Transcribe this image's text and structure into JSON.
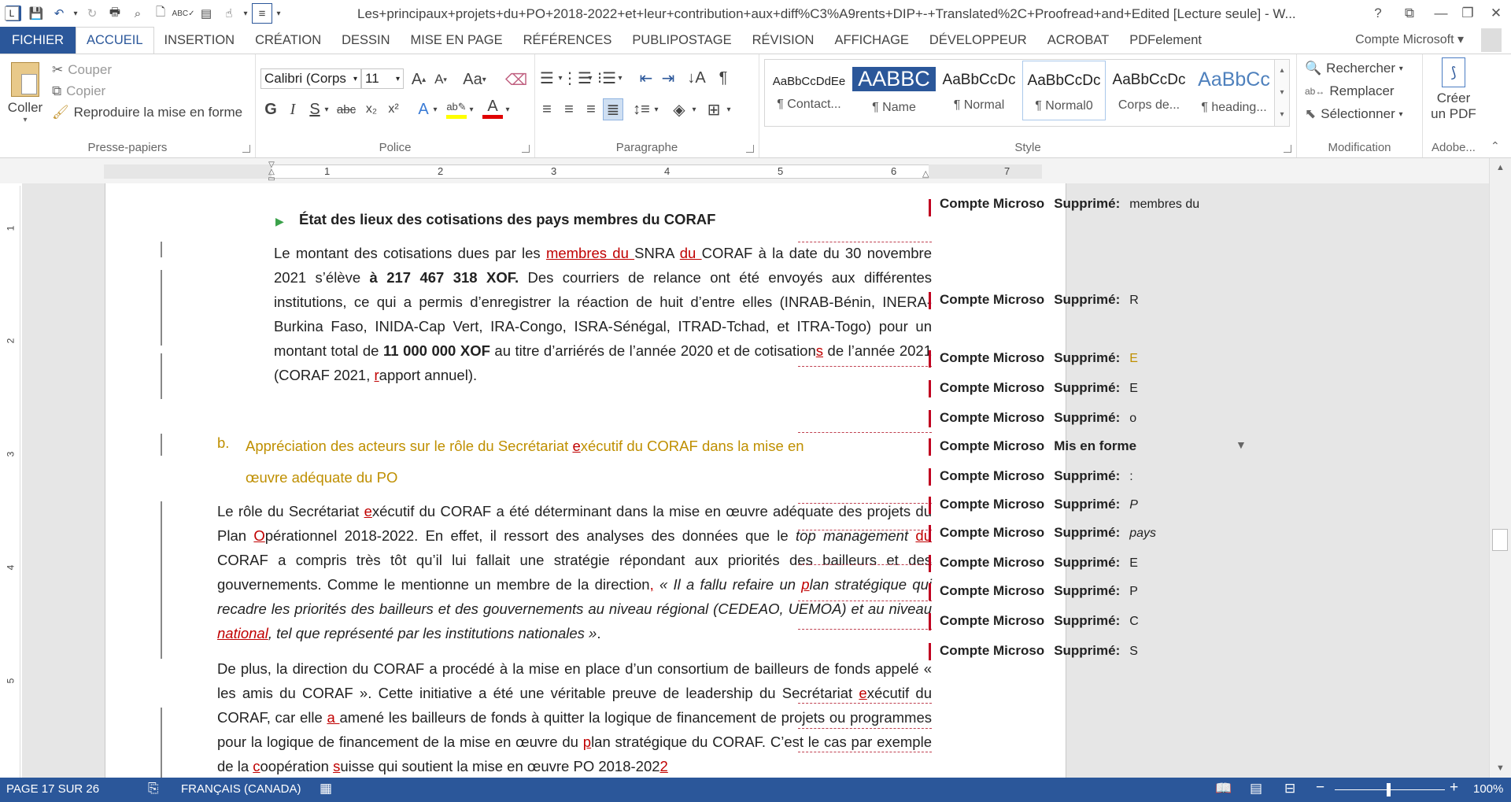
{
  "titlebar": {
    "title": "Les+principaux+projets+du+PO+2018-2022+et+leur+contribution+aux+diff%C3%A9rents+DIP+-+Translated%2C+Proofread+and+Edited [Lecture seule] - W...",
    "help": "?"
  },
  "tabs": [
    {
      "label": "FICHIER"
    },
    {
      "label": "ACCUEIL"
    },
    {
      "label": "INSERTION"
    },
    {
      "label": "CRÉATION"
    },
    {
      "label": "DESSIN"
    },
    {
      "label": "MISE EN PAGE"
    },
    {
      "label": "RÉFÉRENCES"
    },
    {
      "label": "PUBLIPOSTAGE"
    },
    {
      "label": "RÉVISION"
    },
    {
      "label": "AFFICHAGE"
    },
    {
      "label": "DÉVELOPPEUR"
    },
    {
      "label": "ACROBAT"
    },
    {
      "label": "PDFelement"
    }
  ],
  "account": "Compte Microsoft",
  "clipboard": {
    "paste": "Coller",
    "cut": "Couper",
    "copy": "Copier",
    "format_painter": "Reproduire la mise en forme",
    "label": "Presse-papiers"
  },
  "font": {
    "name": "Calibri (Corps",
    "size": "11",
    "label": "Police",
    "bold": "G",
    "italic": "I",
    "underline": "S",
    "strike": "abc",
    "sub": "x₂",
    "sup": "x²",
    "case": "Aa"
  },
  "paragraph": {
    "label": "Paragraphe"
  },
  "styles": {
    "label": "Style",
    "items": [
      {
        "preview": "AaBbCcDdEe",
        "name": "¶ Contact..."
      },
      {
        "preview": "AABBC",
        "name": "¶ Name"
      },
      {
        "preview": "AaBbCcDc",
        "name": "¶ Normal"
      },
      {
        "preview": "AaBbCcDc",
        "name": "¶ Normal0"
      },
      {
        "preview": "AaBbCcDc",
        "name": "Corps de..."
      },
      {
        "preview": "AaBbCc",
        "name": "¶ heading..."
      }
    ]
  },
  "editing": {
    "find": "Rechercher",
    "replace": "Remplacer",
    "select": "Sélectionner",
    "label": "Modification"
  },
  "adobe": {
    "create_pdf_1": "Créer",
    "create_pdf_2": "un PDF",
    "label": "Adobe..."
  },
  "ruler": {
    "numbers": [
      "1",
      "2",
      "3",
      "4",
      "5",
      "6",
      "7"
    ],
    "vnumbers": [
      "1",
      "2",
      "3",
      "4",
      "5"
    ]
  },
  "document": {
    "bullet_heading": "État des lieux des cotisations des pays membres du CORAF",
    "p1": {
      "a": "Le montant des cotisations dues par les ",
      "ins1": "membres du ",
      "b": "SNRA ",
      "ins2": "du ",
      "c": "CORAF à la date du 30 novembre 2021 s’élève ",
      "bold1": "à 217 467 318 XOF.",
      "d": " Des courriers de relance ont été envoyés aux différentes institutions, ce qui a permis d’enregistrer la réaction de huit d’entre elles (INRAB-Bénin, INERA-Burkina Faso, INIDA-Cap Vert, IRA-Congo, ISRA-Sénégal, ITRAD-Tchad, et ITRA-Togo) pour un montant total de ",
      "bold2": "11 000 000 XOF",
      "e": " au titre d’arriérés de l’année 2020 et de cotisation",
      "ins3": "s",
      "f": " de l’année 2021 (CORAF 2021, ",
      "ins4": "r",
      "g": "apport annuel)."
    },
    "heading_b": {
      "letter": "b.",
      "a": "Appréciation des acteurs sur le rôle du Secrétariat ",
      "ins": "e",
      "b": "xécutif du CORAF dans la mise en œuvre adéquate du PO"
    },
    "p2": {
      "a": "Le rôle du Secrétariat ",
      "ins1": "e",
      "b": "xécutif du CORAF a été déterminant dans la mise en œuvre adéquate des projets du Plan ",
      "ins2": "O",
      "c": "pérationnel 2018-2022. En effet, il ressort des analyses des données que le ",
      "it1": "top management ",
      "ins3": "du ",
      "d": "CORAF a compris très tôt qu’il lui fallait une stratégie répondant aux priorités des bailleurs et des gouvernements. Comme le mentionne un membre de la direction",
      "ins4": ",",
      "it2": " « Il a fallu refaire un ",
      "ins5": "p",
      "it3": "lan stratégique qui recadre les priorités des bailleurs et des gouvernements au niveau régional (CEDEAO, UEMOA) et au niveau ",
      "ins6": "national",
      "it4": ", tel que représenté par les institutions nationales »",
      "e": "."
    },
    "p3": {
      "a": "De plus, la direction du CORAF a procédé à la mise en place d’un consortium de bailleurs de fonds appelé « les amis du CORAF ». Cette initiative a été une véritable preuve de leadership du Secrétariat ",
      "ins1": "e",
      "b": "xécutif du CORAF, car elle ",
      "ins2": "a ",
      "c": "amené les bailleurs de fonds à quitter la logique de financement de projets ou programmes pour la logique de financement de la mise en œuvre du ",
      "ins3": "p",
      "d": "lan stratégique du CORAF. C’est le cas par exemple de la ",
      "ins4": "c",
      "e": "oopération ",
      "ins5": "s",
      "f": "uisse qui soutient la mise en œuvre PO 2018-202",
      "ins6": "2"
    }
  },
  "balloons": [
    {
      "author": "Compte Microso",
      "action": "Supprimé:",
      "text": "membres du"
    },
    {
      "author": "Compte Microso",
      "action": "Supprimé:",
      "text": "R"
    },
    {
      "author": "Compte Microso",
      "action": "Supprimé:",
      "text": "E"
    },
    {
      "author": "Compte Microso",
      "action": "Supprimé:",
      "text": "E"
    },
    {
      "author": "Compte Microso",
      "action": "Supprimé:",
      "text": "o"
    },
    {
      "author": "Compte Microso",
      "action": "Mis en forme",
      "text": ""
    },
    {
      "author": "Compte Microso",
      "action": "Supprimé:",
      "text": ":"
    },
    {
      "author": "Compte Microso",
      "action": "Supprimé:",
      "text": "P"
    },
    {
      "author": "Compte Microso",
      "action": "Supprimé:",
      "text": "pays"
    },
    {
      "author": "Compte Microso",
      "action": "Supprimé:",
      "text": "E"
    },
    {
      "author": "Compte Microso",
      "action": "Supprimé:",
      "text": "P"
    },
    {
      "author": "Compte Microso",
      "action": "Supprimé:",
      "text": "C"
    },
    {
      "author": "Compte Microso",
      "action": "Supprimé:",
      "text": "S"
    }
  ],
  "status": {
    "page": "PAGE 17 SUR 26",
    "language": "FRANÇAIS (CANADA)",
    "zoom": "100%",
    "minus": "−",
    "plus": "+"
  },
  "colors": {
    "accent": "#2b579a",
    "insert": "#c00000",
    "heading": "#bf8f00"
  }
}
